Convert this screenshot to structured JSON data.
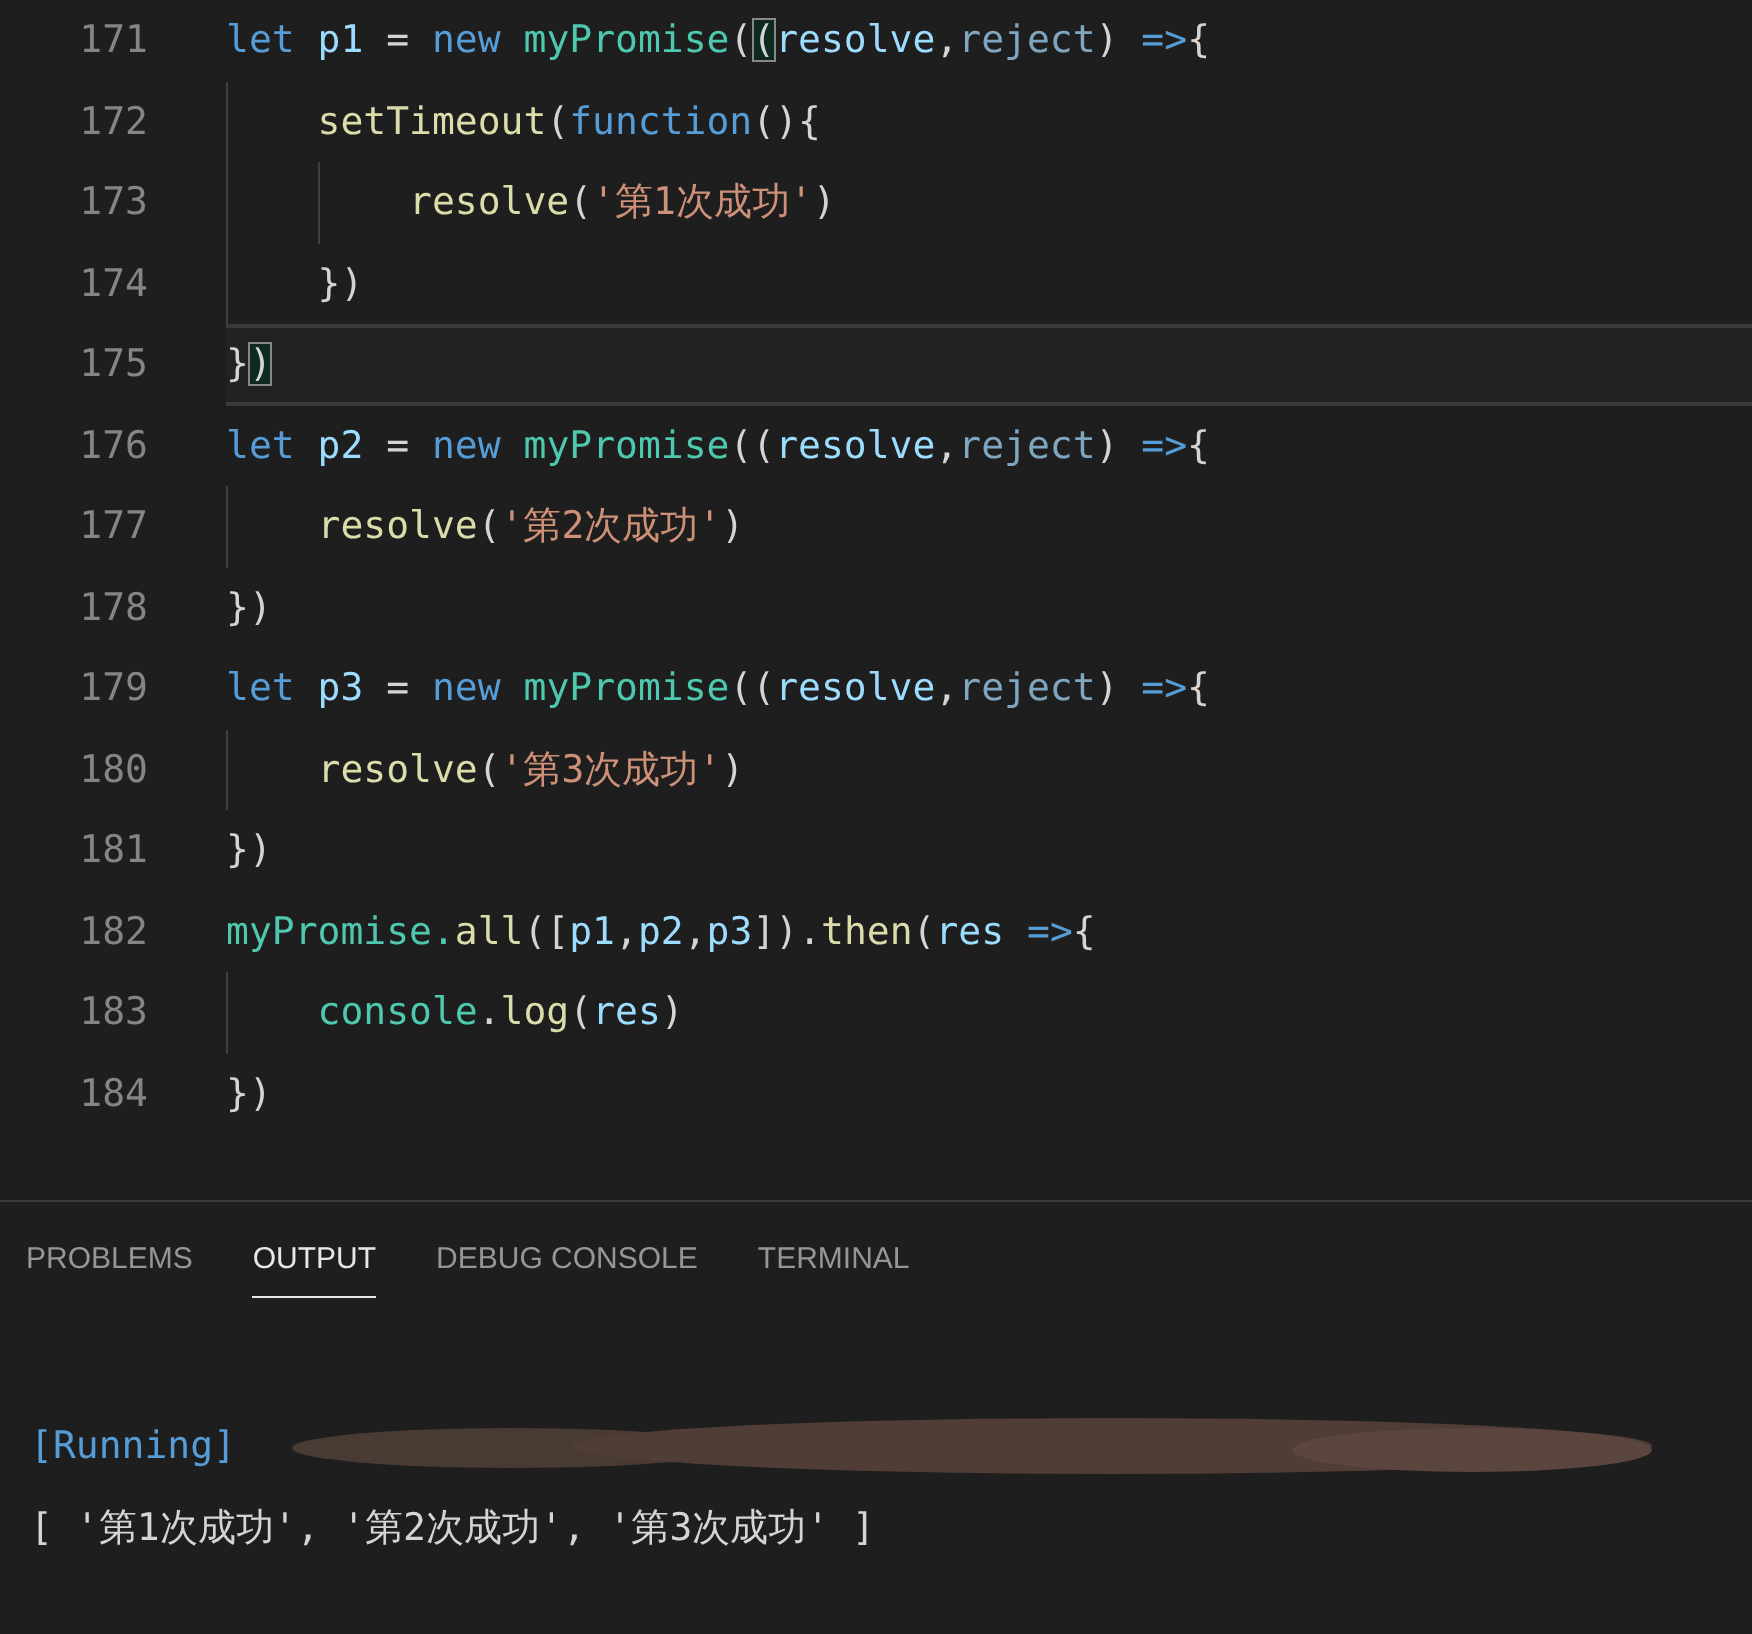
{
  "editor": {
    "lines": [
      {
        "number": "171",
        "current": false,
        "tokens": [
          {
            "kind": "keyword",
            "text": "let "
          },
          {
            "kind": "variable",
            "text": "p1"
          },
          {
            "kind": "punct",
            "text": " = "
          },
          {
            "kind": "keyword",
            "text": "new "
          },
          {
            "kind": "class",
            "text": "myPromise"
          },
          {
            "kind": "punct",
            "text": "("
          },
          {
            "kind": "bracket-match",
            "text": "("
          },
          {
            "kind": "variable",
            "text": "resolve"
          },
          {
            "kind": "punct",
            "text": ","
          },
          {
            "kind": "unused",
            "text": "reject"
          },
          {
            "kind": "punct",
            "text": ") "
          },
          {
            "kind": "keyword",
            "text": "=>"
          },
          {
            "kind": "punct",
            "text": "{"
          }
        ]
      },
      {
        "number": "172",
        "current": false,
        "tokens": [
          {
            "kind": "indent"
          },
          {
            "kind": "function",
            "text": "setTimeout"
          },
          {
            "kind": "punct",
            "text": "("
          },
          {
            "kind": "keyword",
            "text": "function"
          },
          {
            "kind": "punct",
            "text": "(){"
          }
        ]
      },
      {
        "number": "173",
        "current": false,
        "tokens": [
          {
            "kind": "indent"
          },
          {
            "kind": "indent"
          },
          {
            "kind": "function",
            "text": "resolve"
          },
          {
            "kind": "punct",
            "text": "("
          },
          {
            "kind": "string",
            "text": "'第1次成功'"
          },
          {
            "kind": "punct",
            "text": ")"
          }
        ]
      },
      {
        "number": "174",
        "current": false,
        "tokens": [
          {
            "kind": "indent"
          },
          {
            "kind": "punct",
            "text": "})"
          }
        ]
      },
      {
        "number": "175",
        "current": true,
        "tokens": [
          {
            "kind": "punct",
            "text": "}"
          },
          {
            "kind": "bracket-match",
            "text": ")"
          }
        ]
      },
      {
        "number": "176",
        "current": false,
        "tokens": [
          {
            "kind": "keyword",
            "text": "let "
          },
          {
            "kind": "variable",
            "text": "p2"
          },
          {
            "kind": "punct",
            "text": " = "
          },
          {
            "kind": "keyword",
            "text": "new "
          },
          {
            "kind": "class",
            "text": "myPromise"
          },
          {
            "kind": "punct",
            "text": "(("
          },
          {
            "kind": "variable",
            "text": "resolve"
          },
          {
            "kind": "punct",
            "text": ","
          },
          {
            "kind": "unused",
            "text": "reject"
          },
          {
            "kind": "punct",
            "text": ") "
          },
          {
            "kind": "keyword",
            "text": "=>"
          },
          {
            "kind": "punct",
            "text": "{"
          }
        ]
      },
      {
        "number": "177",
        "current": false,
        "tokens": [
          {
            "kind": "indent"
          },
          {
            "kind": "function",
            "text": "resolve"
          },
          {
            "kind": "punct",
            "text": "("
          },
          {
            "kind": "string",
            "text": "'第2次成功'"
          },
          {
            "kind": "punct",
            "text": ")"
          }
        ]
      },
      {
        "number": "178",
        "current": false,
        "tokens": [
          {
            "kind": "punct",
            "text": "})"
          }
        ]
      },
      {
        "number": "179",
        "current": false,
        "tokens": [
          {
            "kind": "keyword",
            "text": "let "
          },
          {
            "kind": "variable",
            "text": "p3"
          },
          {
            "kind": "punct",
            "text": " = "
          },
          {
            "kind": "keyword",
            "text": "new "
          },
          {
            "kind": "class",
            "text": "myPromise"
          },
          {
            "kind": "punct",
            "text": "(("
          },
          {
            "kind": "variable",
            "text": "resolve"
          },
          {
            "kind": "punct",
            "text": ","
          },
          {
            "kind": "unused",
            "text": "reject"
          },
          {
            "kind": "punct",
            "text": ") "
          },
          {
            "kind": "keyword",
            "text": "=>"
          },
          {
            "kind": "punct",
            "text": "{"
          }
        ]
      },
      {
        "number": "180",
        "current": false,
        "tokens": [
          {
            "kind": "indent"
          },
          {
            "kind": "function",
            "text": "resolve"
          },
          {
            "kind": "punct",
            "text": "("
          },
          {
            "kind": "string",
            "text": "'第3次成功'"
          },
          {
            "kind": "punct",
            "text": ")"
          }
        ]
      },
      {
        "number": "181",
        "current": false,
        "tokens": [
          {
            "kind": "punct",
            "text": "})"
          }
        ]
      },
      {
        "number": "182",
        "current": false,
        "tokens": [
          {
            "kind": "plain",
            "text": "myPromise."
          },
          {
            "kind": "function",
            "text": "all"
          },
          {
            "kind": "punct",
            "text": "(["
          },
          {
            "kind": "variable",
            "text": "p1"
          },
          {
            "kind": "punct",
            "text": ","
          },
          {
            "kind": "variable",
            "text": "p2"
          },
          {
            "kind": "punct",
            "text": ","
          },
          {
            "kind": "variable",
            "text": "p3"
          },
          {
            "kind": "punct",
            "text": "])."
          },
          {
            "kind": "function",
            "text": "then"
          },
          {
            "kind": "punct",
            "text": "("
          },
          {
            "kind": "variable",
            "text": "res"
          },
          {
            "kind": "keyword",
            "text": " =>"
          },
          {
            "kind": "punct",
            "text": "{"
          }
        ]
      },
      {
        "number": "183",
        "current": false,
        "tokens": [
          {
            "kind": "indent"
          },
          {
            "kind": "class",
            "text": "console"
          },
          {
            "kind": "punct",
            "text": "."
          },
          {
            "kind": "function",
            "text": "log"
          },
          {
            "kind": "punct",
            "text": "("
          },
          {
            "kind": "variable",
            "text": "res"
          },
          {
            "kind": "punct",
            "text": ")"
          }
        ]
      },
      {
        "number": "184",
        "current": false,
        "tokens": [
          {
            "kind": "punct",
            "text": "})"
          }
        ]
      }
    ]
  },
  "panel": {
    "tabs": [
      {
        "label": "PROBLEMS",
        "selected": false
      },
      {
        "label": "OUTPUT",
        "selected": true
      },
      {
        "label": "DEBUG CONSOLE",
        "selected": false
      },
      {
        "label": "TERMINAL",
        "selected": false
      }
    ],
    "output": [
      {
        "kind": "running",
        "text": "[Running]"
      },
      {
        "kind": "plain",
        "text": "[ '第1次成功', '第2次成功', '第3次成功' ]"
      }
    ]
  }
}
